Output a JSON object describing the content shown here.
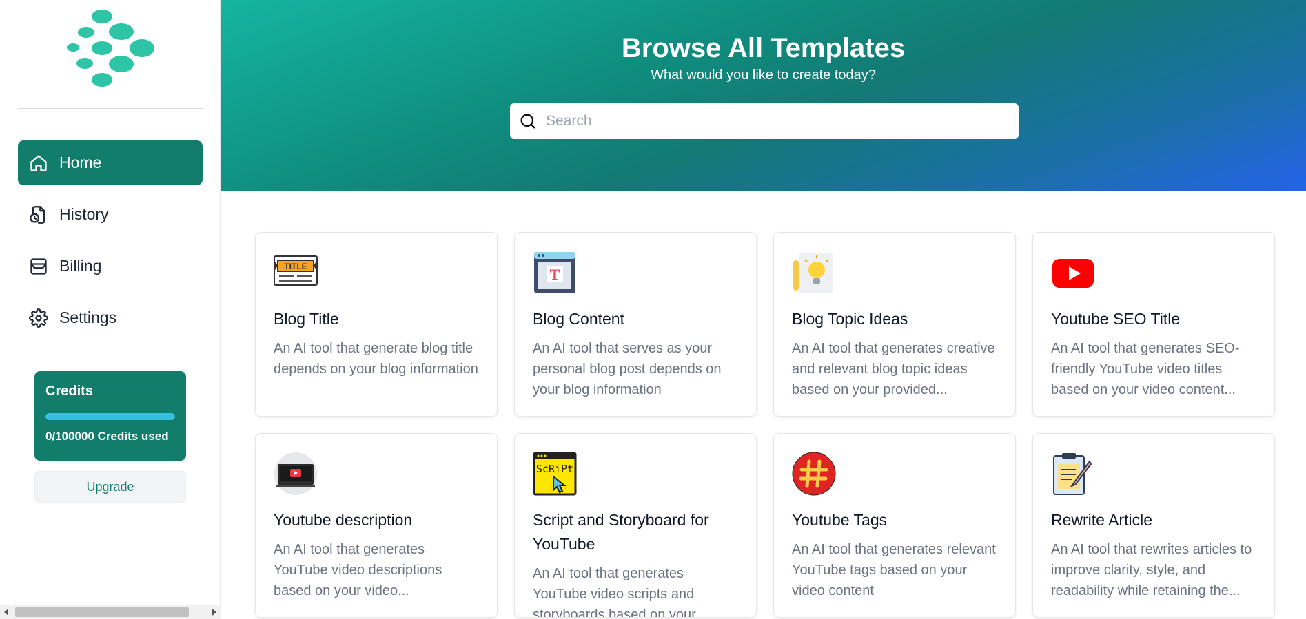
{
  "sidebar": {
    "nav": [
      {
        "label": "Home",
        "icon": "home-icon",
        "active": true
      },
      {
        "label": "History",
        "icon": "history-icon",
        "active": false
      },
      {
        "label": "Billing",
        "icon": "billing-icon",
        "active": false
      },
      {
        "label": "Settings",
        "icon": "settings-icon",
        "active": false
      }
    ],
    "credits": {
      "title": "Credits",
      "used_text": "0/100000 Credits used",
      "used_fraction": 0
    },
    "upgrade_label": "Upgrade"
  },
  "hero": {
    "title": "Browse All Templates",
    "subtitle": "What would you like to create today?",
    "search_placeholder": "Search"
  },
  "templates": [
    {
      "title": "Blog Title",
      "desc": "An AI tool that generate blog title depends on your blog information",
      "icon": "title-tag-icon"
    },
    {
      "title": "Blog Content",
      "desc": "An AI tool that serves as your personal blog post depends on your blog information",
      "icon": "blog-content-icon"
    },
    {
      "title": "Blog Topic Ideas",
      "desc": "An AI tool that generates creative and relevant blog topic ideas based on your provided...",
      "icon": "lightbulb-idea-icon"
    },
    {
      "title": "Youtube SEO Title",
      "desc": "An AI tool that generates SEO-friendly YouTube video titles based on your video content...",
      "icon": "youtube-icon"
    },
    {
      "title": "Youtube description",
      "desc": "An AI tool that generates YouTube video descriptions based on your video...",
      "icon": "video-screen-icon"
    },
    {
      "title": "Script and Storyboard for YouTube",
      "desc": "An AI tool that generates YouTube video scripts and storyboards based on your",
      "icon": "script-icon"
    },
    {
      "title": "Youtube Tags",
      "desc": "An AI tool that generates relevant YouTube tags based on your video content",
      "icon": "hashtag-icon"
    },
    {
      "title": "Rewrite Article",
      "desc": "An AI tool that rewrites articles to improve clarity, style, and readability while retaining the...",
      "icon": "rewrite-article-icon"
    }
  ],
  "colors": {
    "brand": "#127d6b",
    "logo": "#2ec4a6",
    "hero_start": "#15b5a1",
    "hero_end": "#2563eb"
  }
}
